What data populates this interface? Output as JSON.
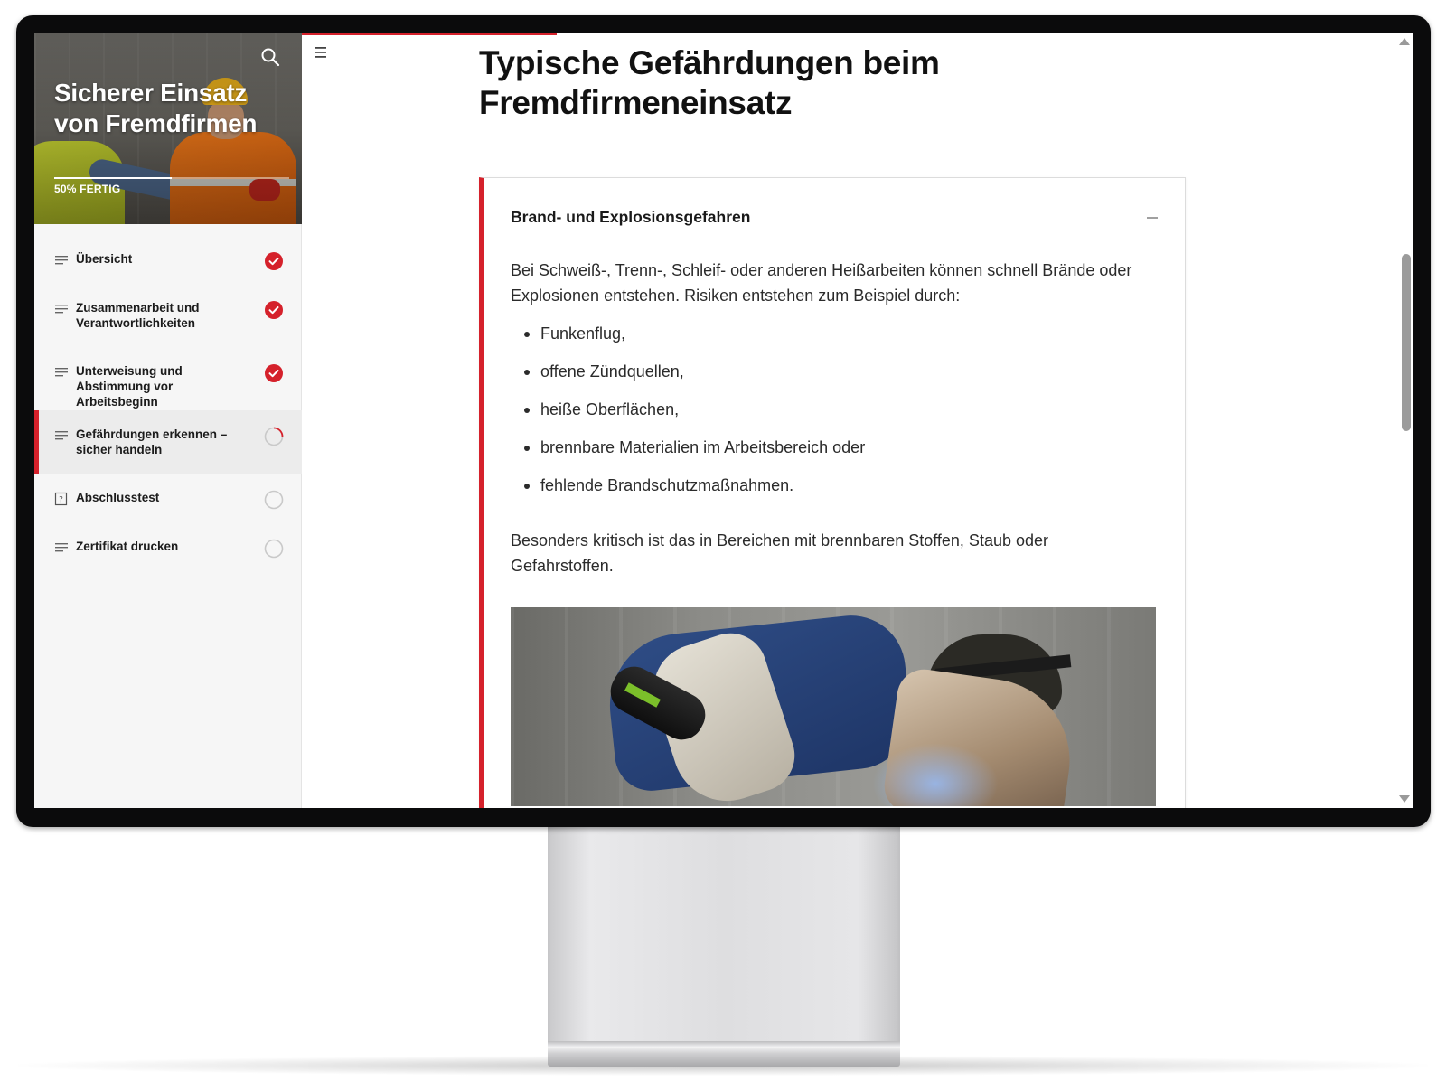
{
  "course": {
    "title": "Sicherer Einsatz von Fremdfirmen",
    "progress_label": "50% FERTIG",
    "progress_fraction": 0.5
  },
  "sidebar": {
    "items": [
      {
        "label": "Übersicht",
        "icon": "lines-icon",
        "status": "complete"
      },
      {
        "label": "Zusammenarbeit und Verantwortlichkeiten",
        "icon": "lines-icon",
        "status": "complete"
      },
      {
        "label": "Unterweisung und Abstimmung vor Arbeitsbeginn",
        "icon": "lines-icon",
        "status": "complete"
      },
      {
        "label": "Gefährdungen erkennen – sicher handeln",
        "icon": "lines-icon",
        "status": "in-progress",
        "active": true
      },
      {
        "label": "Abschlusstest",
        "icon": "quiz-icon",
        "status": "not-started"
      },
      {
        "label": "Zertifikat drucken",
        "icon": "lines-icon",
        "status": "not-started"
      }
    ]
  },
  "main": {
    "title": "Typische Gefährdungen beim Fremdfirmeneinsatz",
    "accordion": {
      "title": "Brand- und Explosionsgefahren",
      "intro": "Bei Schweiß-, Trenn-, Schleif- oder anderen Heißarbeiten können schnell Brände oder Explosionen entstehen. Risiken entstehen zum Beispiel durch:",
      "bullets": [
        "Funkenflug,",
        "offene Zündquellen,",
        "heiße Oberflächen,",
        "brennbare Materialien im Arbeitsbereich oder",
        "fehlende Brandschutzmaßnahmen."
      ],
      "outro": "Besonders kritisch ist das in Bereichen mit brennbaren Stoffen, Staub oder Gefahrstoffen."
    }
  },
  "colors": {
    "accent": "#d5212b",
    "text": "#1c1c1c",
    "sidebar_bg": "#f6f6f6"
  }
}
